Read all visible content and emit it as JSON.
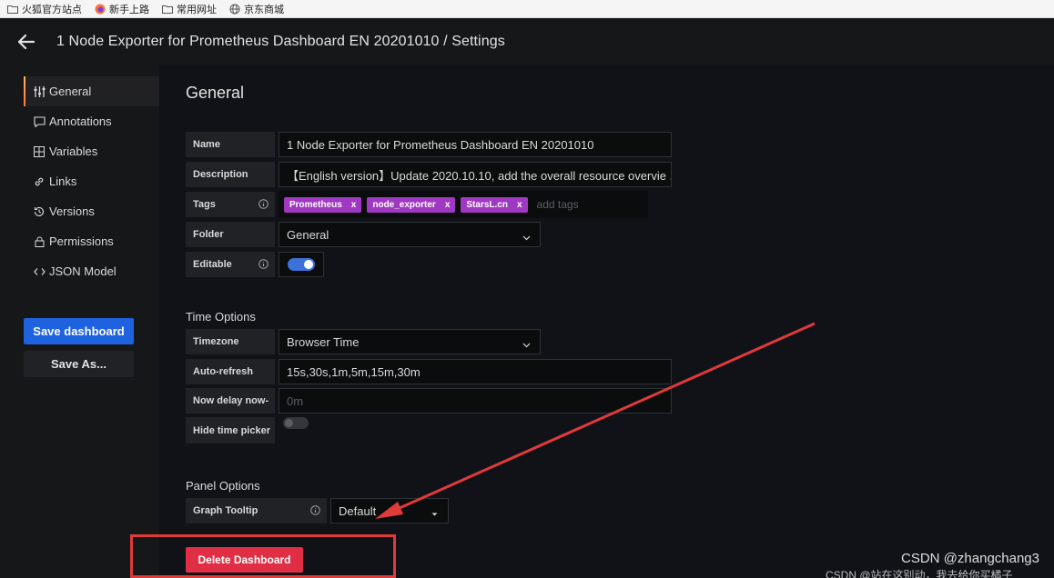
{
  "bookmarks": [
    {
      "label": "火狐官方站点",
      "icon": "folder-icon"
    },
    {
      "label": "新手上路",
      "icon": "firefox-icon"
    },
    {
      "label": "常用网址",
      "icon": "folder-icon"
    },
    {
      "label": "京东商城",
      "icon": "globe-icon"
    }
  ],
  "header": {
    "title": "1 Node Exporter for Prometheus Dashboard EN 20201010 / Settings"
  },
  "sidebar": {
    "items": [
      {
        "label": "General",
        "icon": "sliders-icon",
        "active": true
      },
      {
        "label": "Annotations",
        "icon": "comment-icon"
      },
      {
        "label": "Variables",
        "icon": "calculator-icon"
      },
      {
        "label": "Links",
        "icon": "link-icon"
      },
      {
        "label": "Versions",
        "icon": "history-icon"
      },
      {
        "label": "Permissions",
        "icon": "lock-icon"
      },
      {
        "label": "JSON Model",
        "icon": "code-icon"
      }
    ],
    "save_label": "Save dashboard",
    "save_as_label": "Save As..."
  },
  "general": {
    "heading": "General",
    "name_label": "Name",
    "name_value": "1    Node Exporter for Prometheus Dashboard EN 20201010",
    "description_label": "Description",
    "description_value": "【English version】Update 2020.10.10, add the overall resource overvie  ...",
    "tags_label": "Tags",
    "tags": [
      "Prometheus",
      "node_exporter",
      "StarsL.cn"
    ],
    "tag_remove": "x",
    "tags_placeholder": "add tags",
    "folder_label": "Folder",
    "folder_value": "General",
    "editable_label": "Editable",
    "editable_on": true
  },
  "time_options": {
    "heading": "Time Options",
    "timezone_label": "Timezone",
    "timezone_value": "Browser Time",
    "autorefresh_label": "Auto-refresh",
    "autorefresh_value": "15s,30s,1m,5m,15m,30m",
    "nowdelay_label": "Now delay now-",
    "nowdelay_placeholder": "0m",
    "hide_picker_label": "Hide time picker",
    "hide_picker_on": false
  },
  "panel_options": {
    "heading": "Panel Options",
    "tooltip_label": "Graph Tooltip",
    "tooltip_value": "Default"
  },
  "delete_label": "Delete Dashboard",
  "annotation": {
    "highlight_color": "#e03a3a"
  },
  "watermark": {
    "line1": "CSDN @zhangchang3",
    "line2": "CSDN @站在这别动，我去给你买橘子"
  },
  "colors": {
    "primary": "#1f62e0",
    "danger": "#e02f44",
    "tag": "#a039c2",
    "active_accent": "#ff7941"
  }
}
